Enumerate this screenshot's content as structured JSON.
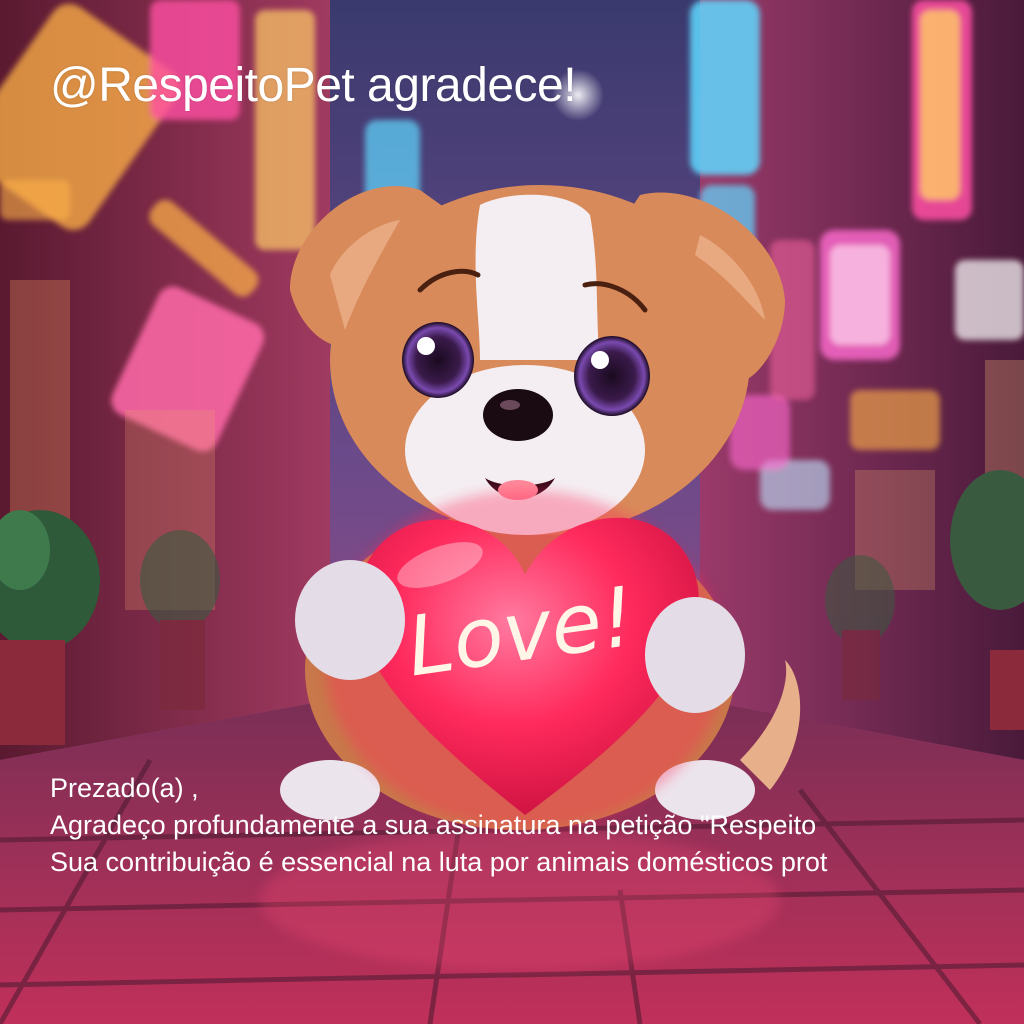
{
  "post": {
    "headline": "@RespeitoPet agradece!",
    "greeting": "Prezado(a)  ,",
    "line1": "Agradeço profundamente a sua assinatura na petição \"Respeito",
    "line2": "Sua contribuição é essencial na luta por animais domésticos prot"
  },
  "illustration": {
    "subject": "puppy holding heart",
    "heart_text": "Love!",
    "colors": {
      "heart": "#ff2a5c",
      "fur_orange": "#d98a5a",
      "fur_white": "#f4eef2",
      "neon_pink": "#ff4fa3",
      "neon_cyan": "#5fd8ff",
      "neon_amber": "#ffb347"
    }
  }
}
